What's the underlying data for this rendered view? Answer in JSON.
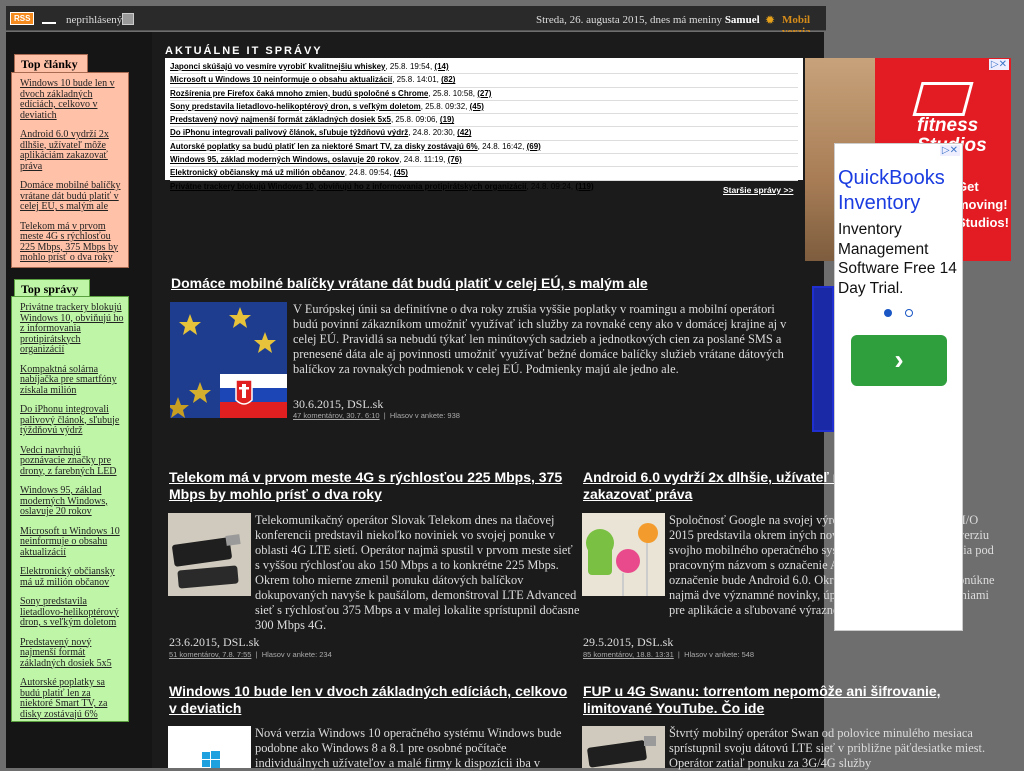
{
  "topbar": {
    "rss_label": "RSS",
    "login_text": "neprihlásený",
    "date_prefix": "Streda, 26. augusta 2015, dnes má meniny ",
    "nameday": "Samuel",
    "mobile_link": "Mobil verzia"
  },
  "sidebar": {
    "top_clanky_title": "Top články",
    "top_clanky": [
      "Windows 10 bude len v dvoch základných edíciách, celkovo v deviatich",
      "Android 6.0 vydrží 2x dlhšie, užívateľ môže aplikáciám zakazovať práva",
      "Domáce mobilné balíčky vrátane dát budú platiť v celej EÚ, s malým ale",
      "Telekom má v prvom meste 4G s rýchlosťou 225 Mbps, 375 Mbps by mohlo prísť o dva roky"
    ],
    "top_spravy_title": "Top správy",
    "top_spravy": [
      "Privátne trackery blokujú Windows 10, obviňujú ho z informovania protipirátskych organizácií",
      "Kompaktná solárna nabíjačka pre smartfóny získala milión",
      "Do iPhonu integrovali palivový článok, sľubuje týždňovú výdrž",
      "Vedci navrhujú poznávacie značky pre drony, z farebných LED",
      "Windows 95, základ moderných Windows, oslavuje 20 rokov",
      "Microsoft u Windows 10 neinformuje o obsahu aktualizácií",
      "Elektronický občiansky má už milión občanov",
      "Sony predstavila lietadlovo-helikoptérový dron, s veľkým doletom",
      "Predstavený nový najmenší formát základných dosiek 5x5",
      "Autorské poplatky sa budú platiť len za niektoré Smart TV, za disky zostávajú 6%"
    ]
  },
  "news": {
    "heading": "AKTUÁLNE IT SPRÁVY",
    "older_link": "Staršie správy  >>",
    "items": [
      {
        "title": "Japonci skúšajú vo vesmíre vyrobiť kvalitnejšiu whiskey",
        "time": ", 25.8. 19:54, ",
        "count": "(14)"
      },
      {
        "title": "Microsoft u Windows 10 neinformuje o obsahu aktualizácií",
        "time": ", 25.8. 14:01, ",
        "count": "(82)"
      },
      {
        "title": "Rozšírenia pre Firefox čaká mnoho zmien, budú spoločné s Chrome",
        "time": ", 25.8. 10:58, ",
        "count": "(27)"
      },
      {
        "title": "Sony predstavila lietadlovo-helikoptérový dron, s veľkým doletom",
        "time": ", 25.8. 09:32, ",
        "count": "(45)"
      },
      {
        "title": "Predstavený nový najmenší formát základných dosiek 5x5",
        "time": ", 25.8. 09:06, ",
        "count": "(19)"
      },
      {
        "title": "Do iPhonu integrovali palivový článok, sľubuje týždňovú výdrž",
        "time": ", 24.8. 20:30, ",
        "count": "(42)"
      },
      {
        "title": "Autorské poplatky sa budú platiť len za niektoré Smart TV, za disky zostávajú 6%",
        "time": ", 24.8. 16:42, ",
        "count": "(69)"
      },
      {
        "title": "Windows 95, základ moderných Windows, oslavuje 20 rokov",
        "time": ", 24.8. 11:19, ",
        "count": "(76)"
      },
      {
        "title": "Elektronický občiansky má už milión občanov",
        "time": ", 24.8. 09:54, ",
        "count": "(45)"
      },
      {
        "title": "Privátne trackery blokujú Windows 10, obviňujú ho z informovania protipirátskych organizácií",
        "time": ", 24.8. 09:24, ",
        "count": "(119)"
      }
    ]
  },
  "articles": {
    "a1": {
      "title": "Domáce mobilné balíčky vrátane dát budú platiť v celej EÚ, s malým ale",
      "text": "V Európskej únii sa definitívne o dva roky zrušia vyššie poplatky v roamingu a mobilní operátori budú povinní zákazníkom umožniť využívať ich služby za rovnaké ceny ako v domácej krajine aj v celej EÚ. Pravidlá sa nebudú týkať len minútových sadzieb a jednotkových cien za poslané SMS a prenesené dáta ale aj povinnosti umožniť využívať bežné domáce balíčky služieb vrátane dátových balíčkov za rovnakých podmienok v celej EÚ. Podmienky majú ale jedno ale.",
      "date": "30.6.2015, DSL.sk",
      "comments": "47 komentárov, 30.7. 6:10",
      "votes": "Hlasov v ankete: 938"
    },
    "a2": {
      "title": "Telekom má v prvom meste 4G s rýchlosťou 225 Mbps, 375 Mbps by mohlo prísť o dva roky",
      "text": "Telekomunikačný operátor Slovak Telekom dnes na tlačovej konferencii predstavil niekoľko noviniek vo svojej ponuke v oblasti 4G LTE sietí. Operátor najmä spustil v prvom meste sieť s vyššou rýchlosťou ako 150 Mbps a to konkrétne 225 Mbps. Okrem toho mierne zmenil ponuku dátových balíčkov dokupovaných navyše k paušálom, demonštroval LTE Advanced sieť s rýchlosťou 375 Mbps a v malej lokalite sprístupnil dočasne 300 Mbps 4G.",
      "date": "23.6.2015, DSL.sk",
      "comments": "51 komentárov, 7.8. 7:55",
      "votes": "Hlasov v ankete: 234"
    },
    "a3": {
      "title": "Android 6.0 vydrží 2x dlhšie, užívateľ môže aplikáciám zakazovať práva",
      "text": "Spoločnosť Google na svojej výročnej konferencii Google I/O 2015 predstavila okrem iných noviniek v novinkách novú verziu svojho mobilného operačného systému Android. Nová verzia pod pracovným názvom s označenie Android M a jej číselné označenie bude Android 6.0. Okrem noviniek v rozhraní ponúkne najmä dve významné novinky, úplnú kontrolu nad oprávneniami pre aplikácie a sľubované výrazné predĺženie výdrže.",
      "date": "29.5.2015, DSL.sk",
      "comments": "85 komentárov, 18.8. 13:31",
      "votes": "Hlasov v ankete: 548"
    },
    "a4": {
      "title": "Windows 10 bude len v dvoch základných edíciách, celkovo v deviatich",
      "text": "Nová verzia Windows 10 operačného systému Windows bude podobne ako Windows 8 a 8.1 pre osobné počítače individuálnych užívateľov a malé firmy k dispozícii iba v"
    },
    "a5": {
      "title": "FUP u 4G Swanu: torrentom nepomôže ani šifrovanie, limitované YouTube. Čo ide",
      "text": "Štvrtý mobilný operátor Swan od polovice minulého mesiaca sprístupnil svoju dátovú LTE sieť v približne päťdesiatke miest. Operátor zatiaľ ponuku za 3G/4G služby"
    }
  },
  "ads": {
    "fitness_text": "fitness Studios",
    "fitness_sub": "Get moving! Studios!",
    "qb_title": "QuickBooks Inventory",
    "qb_body": "Inventory Management Software Free 14 Day Trial.",
    "qb_button": "›",
    "close_label": "▷✕"
  },
  "colors": {
    "top_clanky_bg": "#ffc1a8",
    "top_spravy_bg": "#bff5a7",
    "main_bg": "#1b1b1b",
    "page_bg": "#6e6e6e"
  }
}
